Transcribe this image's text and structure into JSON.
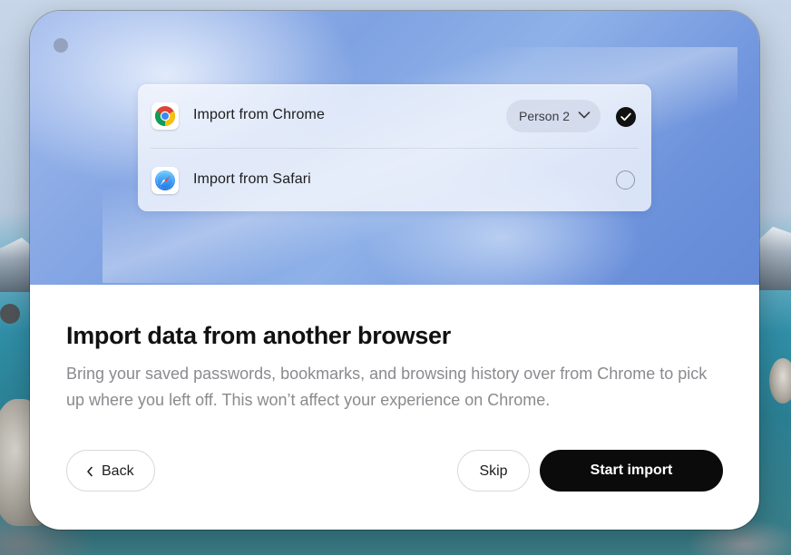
{
  "hero": {
    "rows": [
      {
        "label": "Import from Chrome",
        "icon": "chrome-icon",
        "profile": "Person 2",
        "selected": true
      },
      {
        "label": "Import from Safari",
        "icon": "safari-icon",
        "selected": false
      }
    ]
  },
  "content": {
    "title": "Import data from another browser",
    "description": "Bring your saved passwords, bookmarks, and browsing history over from Chrome to pick up where you left off. This won’t affect your experience on Chrome."
  },
  "actions": {
    "back_label": "Back",
    "skip_label": "Skip",
    "start_label": "Start import"
  },
  "colors": {
    "primary_button": "#0b0b0c",
    "hero_gradient_start": "#9fb9ec",
    "hero_gradient_end": "#6489d6"
  }
}
